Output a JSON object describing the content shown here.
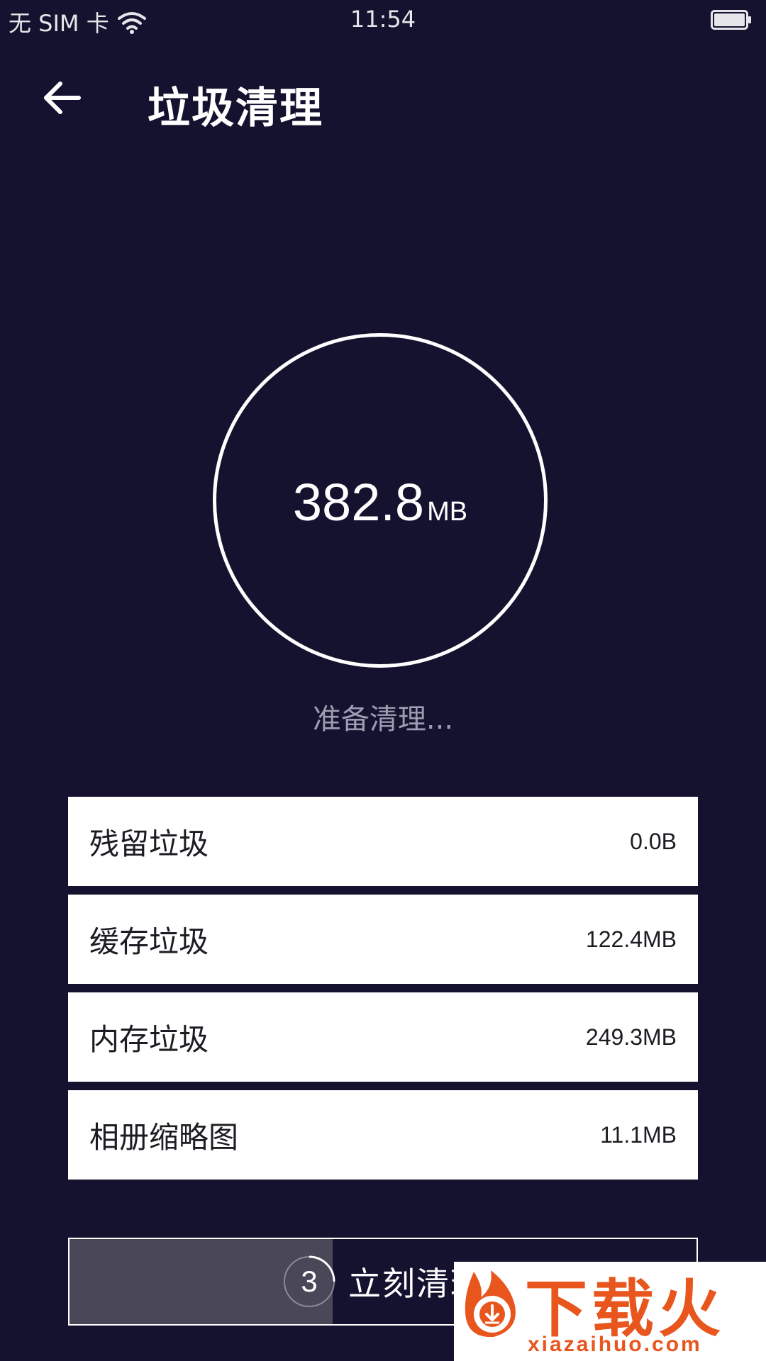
{
  "status_bar": {
    "carrier": "无 SIM 卡",
    "time": "11:54"
  },
  "header": {
    "title": "垃圾清理"
  },
  "junk_total": {
    "value": "382.8",
    "unit": "MB"
  },
  "scan_status": "准备清理...",
  "junk_items": [
    {
      "label": "残留垃圾",
      "value": "0.0B"
    },
    {
      "label": "缓存垃圾",
      "value": "122.4MB"
    },
    {
      "label": "内存垃圾",
      "value": "249.3MB"
    },
    {
      "label": "相册缩略图",
      "value": "11.1MB"
    }
  ],
  "clean_button": {
    "countdown": "3",
    "label": "立刻清理",
    "progress_fraction": 0.42
  },
  "watermark": {
    "brand": "下载火",
    "url": "xiazaihuo.com"
  },
  "colors": {
    "background": "#14122f",
    "row_background": "#ffffff",
    "progress_fill": "#4a4759",
    "watermark_accent": "#e8561e"
  }
}
